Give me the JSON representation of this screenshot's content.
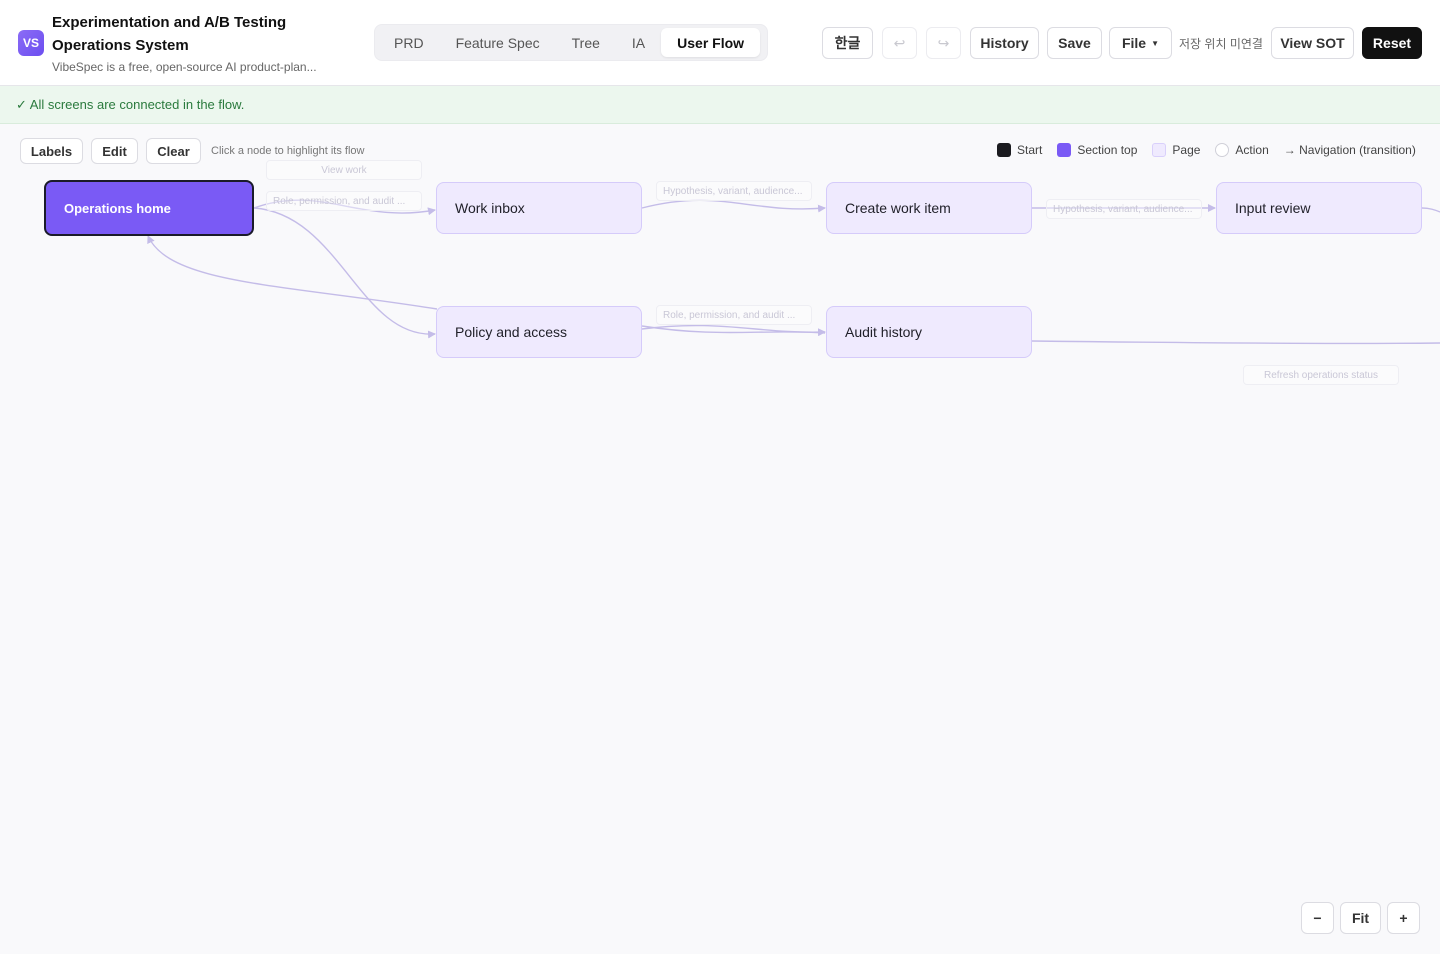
{
  "app": {
    "logo_text": "VS",
    "title": "Experimentation and A/B Testing Operations System",
    "subtitle": "VibeSpec is a free, open-source AI product-plan..."
  },
  "tabs": [
    {
      "label": "PRD",
      "active": false
    },
    {
      "label": "Feature Spec",
      "active": false
    },
    {
      "label": "Tree",
      "active": false
    },
    {
      "label": "IA",
      "active": false
    },
    {
      "label": "User Flow",
      "active": true
    }
  ],
  "header_actions": {
    "language": "한글",
    "undo_icon": "↩",
    "redo_icon": "↪",
    "history": "History",
    "save": "Save",
    "file": "File",
    "save_location": "저장 위치 미연결",
    "view_sot": "View SOT",
    "reset": "Reset"
  },
  "banner": {
    "text": "✓ All screens are connected in the flow."
  },
  "toolbar": {
    "labels": "Labels",
    "edit": "Edit",
    "clear": "Clear",
    "hint": "Click a node to highlight its flow"
  },
  "legend": {
    "start": "Start",
    "section_top": "Section top",
    "page": "Page",
    "action": "Action",
    "navigation": "→ Navigation (transition)"
  },
  "nodes": {
    "operations_home": "Operations home",
    "work_inbox": "Work inbox",
    "create_work_item": "Create work item",
    "input_review": "Input review",
    "policy_and_access": "Policy and access",
    "audit_history": "Audit history"
  },
  "edge_labels": {
    "view_work": "View work",
    "role_permission_1": "Role, permission, and audit ...",
    "hypothesis_1": "Hypothesis, variant, audience...",
    "hypothesis_2": "Hypothesis, variant, audience...",
    "role_permission_2": "Role, permission, and audit ...",
    "refresh_status": "Refresh operations status"
  },
  "zoom": {
    "out": "−",
    "fit": "Fit",
    "in": "+"
  },
  "colors": {
    "section_node": "#7a5af5",
    "page_node": "#efeafe",
    "edge": "#c4bce8",
    "banner_bg": "#ecf7ee",
    "banner_text": "#2a7a3d"
  }
}
